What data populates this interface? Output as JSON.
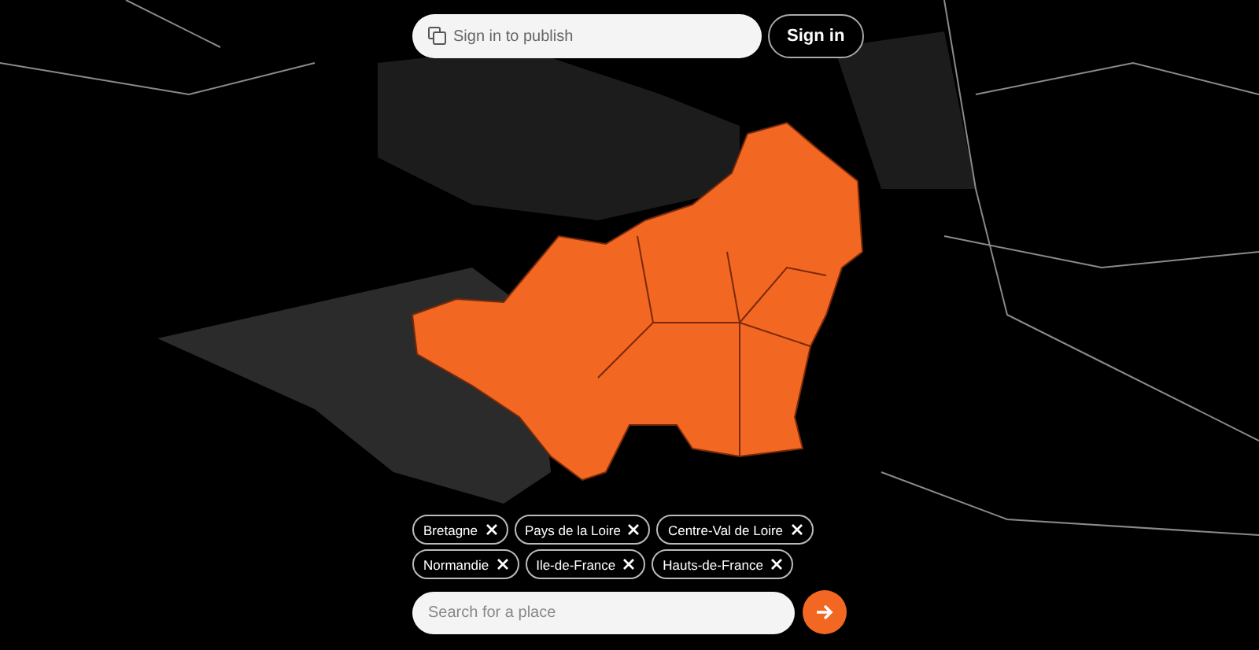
{
  "top_bar": {
    "publish_field": {
      "placeholder": "Sign in to publish"
    },
    "sign_in_button": "Sign in"
  },
  "selected_regions": [
    {
      "label": "Bretagne"
    },
    {
      "label": "Pays de la Loire"
    },
    {
      "label": "Centre-Val de Loire"
    },
    {
      "label": "Normandie"
    },
    {
      "label": "Ile-de-France"
    },
    {
      "label": "Hauts-de-France"
    }
  ],
  "search": {
    "placeholder": "Search for a place"
  }
}
